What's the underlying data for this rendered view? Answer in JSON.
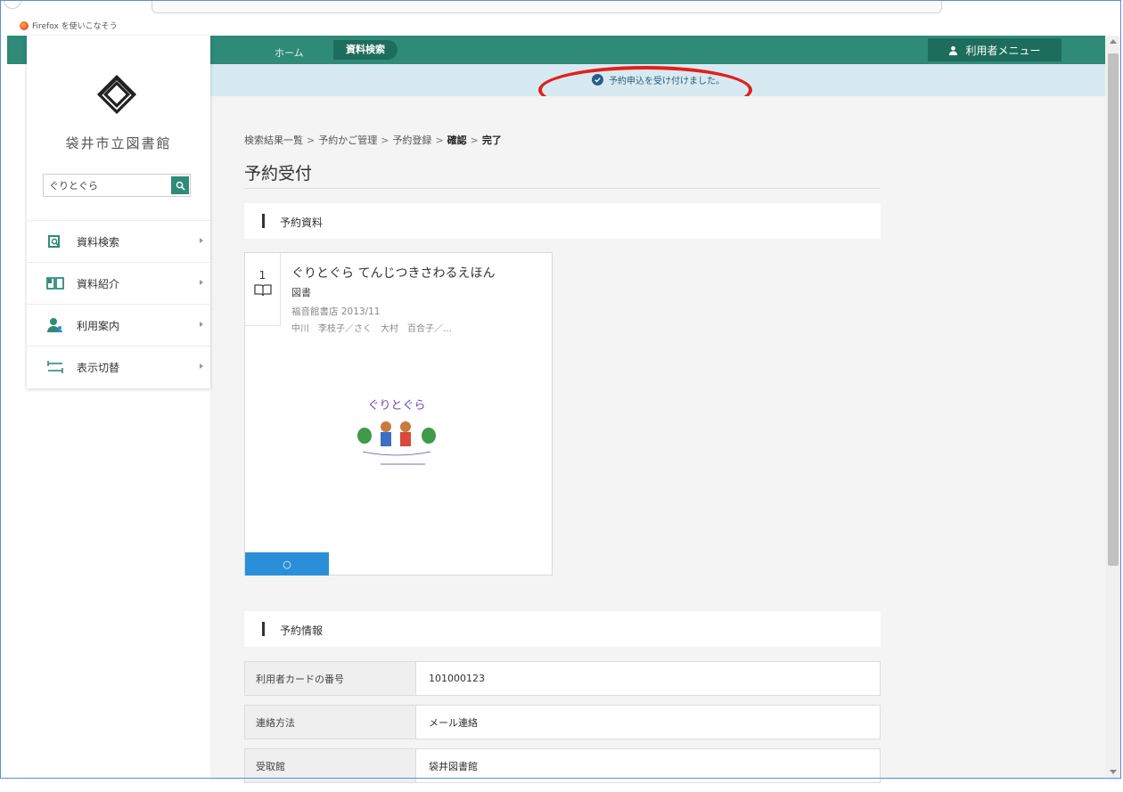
{
  "browser": {
    "bookmark_label": "Firefox を使いこなそう"
  },
  "topnav": {
    "home": "ホーム",
    "search": "資料検索",
    "user_menu": "利用者メニュー"
  },
  "notice": {
    "message": "予約申込を受け付けました。"
  },
  "sidebar": {
    "library_name": "袋井市立図書館",
    "search_value": "ぐりとぐら",
    "items": [
      {
        "label": "資料検索",
        "icon": "book-search-icon"
      },
      {
        "label": "資料紹介",
        "icon": "open-book-icon"
      },
      {
        "label": "利用案内",
        "icon": "users-icon"
      },
      {
        "label": "表示切替",
        "icon": "swap-arrows-icon"
      }
    ]
  },
  "breadcrumb": {
    "items": [
      "検索結果一覧",
      "予約かご管理",
      "予約登録",
      "確認",
      "完了"
    ],
    "separator": ">"
  },
  "page_title": "予約受付",
  "sections": {
    "material": "予約資料",
    "info": "予約情報"
  },
  "book": {
    "number": "1",
    "title": "ぐりとぐら てんじつきさわるえほん",
    "type": "図書",
    "publisher": "福音館書店 2013/11",
    "authors": "中川　李枝子／さく　大村　百合子／…",
    "cover_title": "ぐりとぐら",
    "button_label": "○"
  },
  "info_rows": [
    {
      "label": "利用者カードの番号",
      "value": "101000123"
    },
    {
      "label": "連絡方法",
      "value": "メール連絡"
    },
    {
      "label": "受取館",
      "value": "袋井図書館"
    }
  ],
  "colors": {
    "topbar": "#2f8a78",
    "topbar_active": "#1e6d5c",
    "notice_bg": "#d8eaf1",
    "annotation_ellipse": "#e3201b",
    "reserve_button": "#2a8fd8"
  }
}
